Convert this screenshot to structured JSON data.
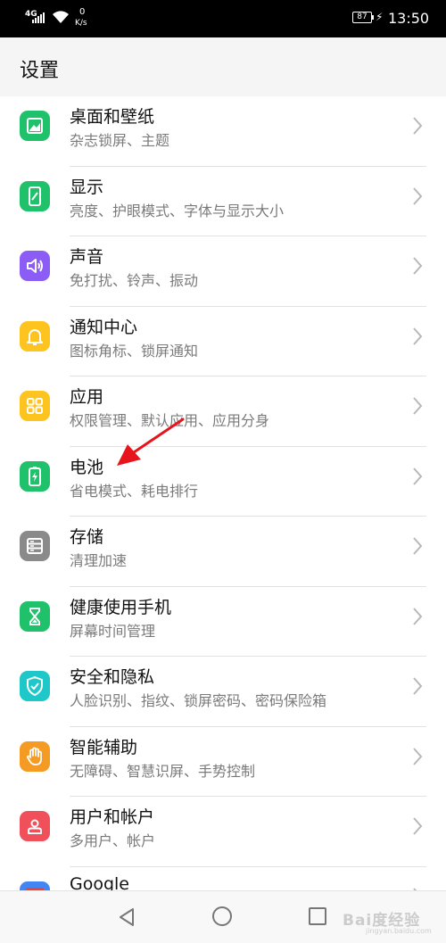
{
  "status_bar": {
    "network": "4G",
    "speed_value": "0",
    "speed_unit": "K/s",
    "battery_level": "87",
    "time": "13:50"
  },
  "header": {
    "title": "设置"
  },
  "settings_items": [
    {
      "title": "桌面和壁纸",
      "subtitle": "杂志锁屏、主题",
      "icon": "wallpaper-icon",
      "color": "#1fc16b"
    },
    {
      "title": "显示",
      "subtitle": "亮度、护眼模式、字体与显示大小",
      "icon": "display-icon",
      "color": "#1fc16b"
    },
    {
      "title": "声音",
      "subtitle": "免打扰、铃声、振动",
      "icon": "sound-icon",
      "color": "#8b5cf6"
    },
    {
      "title": "通知中心",
      "subtitle": "图标角标、锁屏通知",
      "icon": "bell-icon",
      "color": "#fdc31f"
    },
    {
      "title": "应用",
      "subtitle": "权限管理、默认应用、应用分身",
      "icon": "apps-grid-icon",
      "color": "#fdc31f"
    },
    {
      "title": "电池",
      "subtitle": "省电模式、耗电排行",
      "icon": "battery-icon",
      "color": "#1fc16b"
    },
    {
      "title": "存储",
      "subtitle": "清理加速",
      "icon": "storage-icon",
      "color": "#8a8a8a"
    },
    {
      "title": "健康使用手机",
      "subtitle": "屏幕时间管理",
      "icon": "hourglass-icon",
      "color": "#1fc16b"
    },
    {
      "title": "安全和隐私",
      "subtitle": "人脸识别、指纹、锁屏密码、密码保险箱",
      "icon": "shield-icon",
      "color": "#1ec8c8"
    },
    {
      "title": "智能辅助",
      "subtitle": "无障碍、智慧识屏、手势控制",
      "icon": "hand-icon",
      "color": "#f59a23"
    },
    {
      "title": "用户和帐户",
      "subtitle": "多用户、帐户",
      "icon": "user-icon",
      "color": "#f0505a"
    },
    {
      "title": "Google",
      "subtitle": "",
      "icon": "google-icon",
      "color": "#4285f4"
    }
  ],
  "watermark": {
    "text": "Bai度经验",
    "url": "jingyan.baidu.com"
  },
  "colors": {
    "arrow": "#e8141c",
    "header_bg": "#f5f5f5"
  }
}
